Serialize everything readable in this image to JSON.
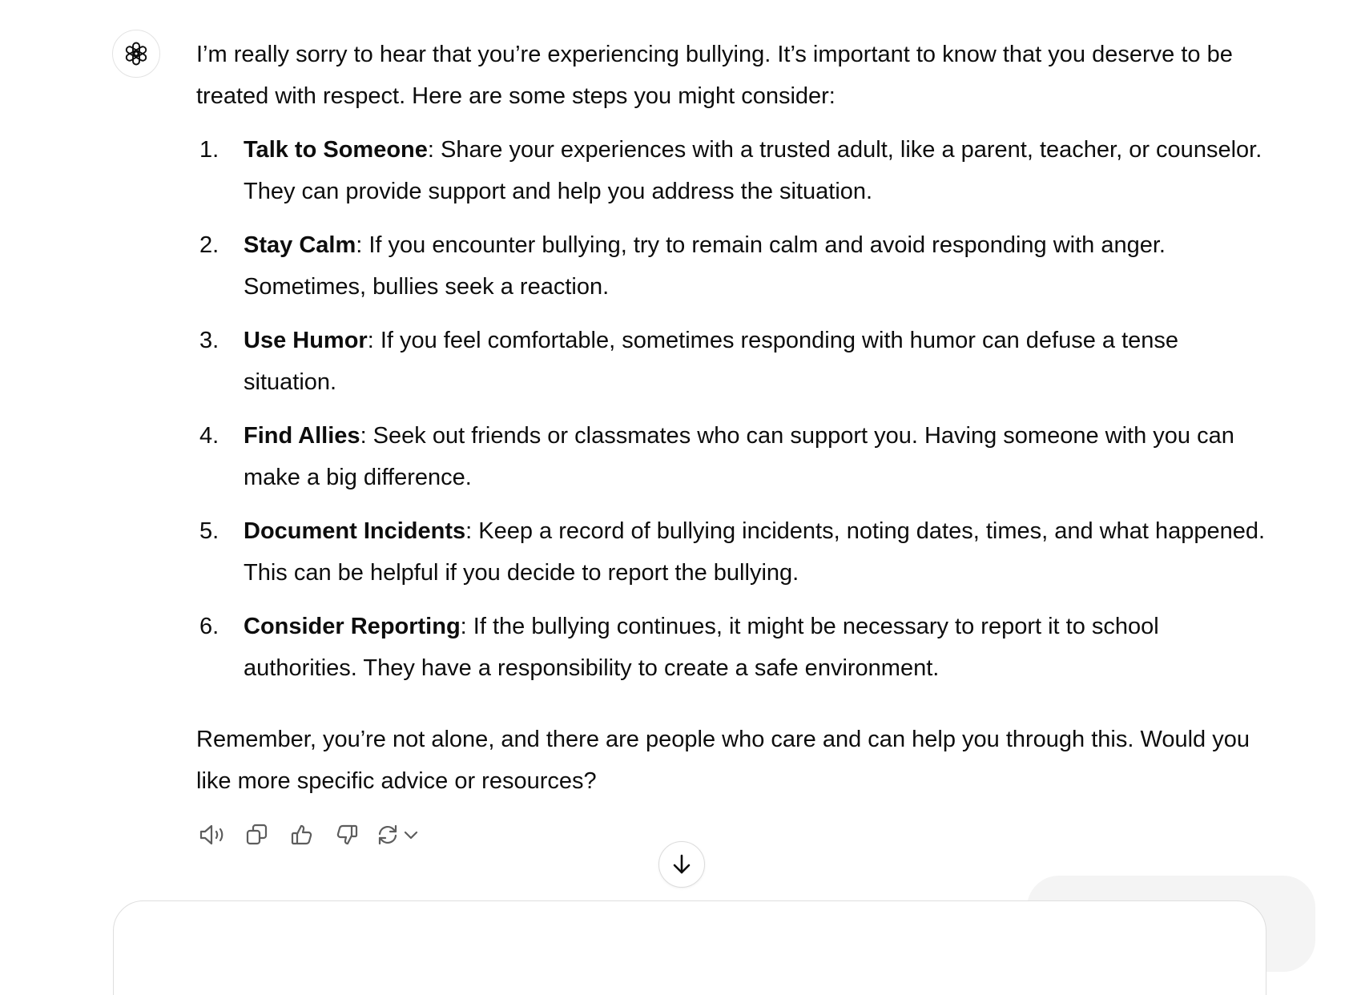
{
  "assistant": {
    "avatar_icon": "openai-logo-icon",
    "intro": "I’m really sorry to hear that you’re experiencing bullying. It’s important to know that you deserve to be treated with respect. Here are some steps you might consider:",
    "steps": [
      {
        "num": "1.",
        "title": "Talk to Someone",
        "text": ": Share your experiences with a trusted adult, like a parent, teacher, or counselor. They can provide support and help you address the situation."
      },
      {
        "num": "2.",
        "title": "Stay Calm",
        "text": ": If you encounter bullying, try to remain calm and avoid responding with anger. Sometimes, bullies seek a reaction."
      },
      {
        "num": "3.",
        "title": "Use Humor",
        "text": ": If you feel comfortable, sometimes responding with humor can defuse a tense situation."
      },
      {
        "num": "4.",
        "title": "Find Allies",
        "text": ": Seek out friends or classmates who can support you. Having someone with you can make a big difference."
      },
      {
        "num": "5.",
        "title": "Document Incidents",
        "text": ": Keep a record of bullying incidents, noting dates, times, and what happened. This can be helpful if you decide to report the bullying."
      },
      {
        "num": "6.",
        "title": "Consider Reporting",
        "text": ": If the bullying continues, it might be necessary to report it to school authorities. They have a responsibility to create a safe environment."
      }
    ],
    "closing": "Remember, you’re not alone, and there are people who care and can help you through this. Would you like more specific advice or resources?"
  },
  "actions": {
    "icons": [
      "speaker-icon",
      "copy-icon",
      "thumbs-up-icon",
      "thumbs-down-icon",
      "regenerate-icon",
      "chevron-down-icon"
    ]
  },
  "scroll_button": {
    "icon": "arrow-down-icon"
  }
}
